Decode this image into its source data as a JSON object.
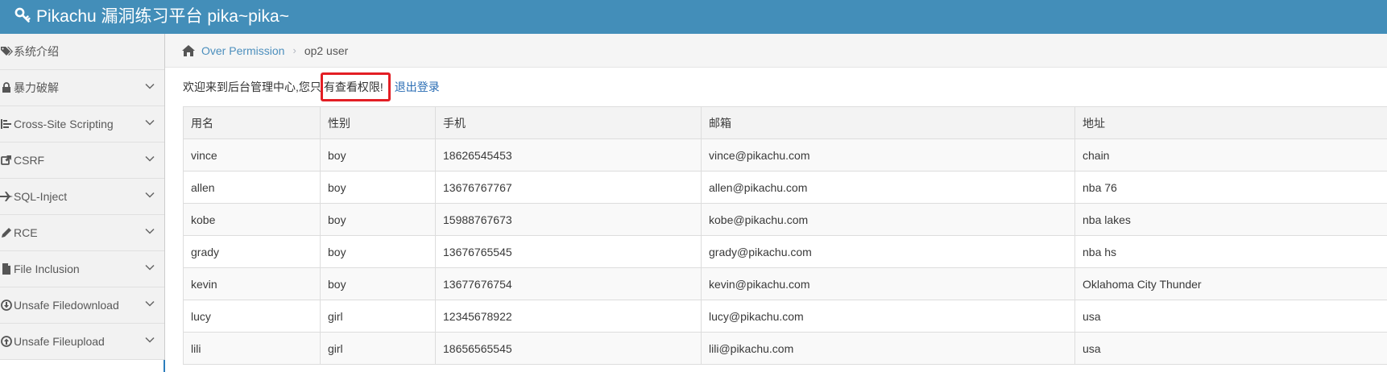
{
  "header": {
    "title": "Pikachu 漏洞练习平台 pika~pika~",
    "icon": "key-icon"
  },
  "sidebar": {
    "items": [
      {
        "label": "系统介绍",
        "icon": "tags-icon"
      },
      {
        "label": "暴力破解",
        "icon": "lock-icon"
      },
      {
        "label": "Cross-Site Scripting",
        "icon": "list-icon"
      },
      {
        "label": "CSRF",
        "icon": "share-icon"
      },
      {
        "label": "SQL-Inject",
        "icon": "fighter-jet-icon"
      },
      {
        "label": "RCE",
        "icon": "pencil-icon"
      },
      {
        "label": "File Inclusion",
        "icon": "file-icon"
      },
      {
        "label": "Unsafe Filedownload",
        "icon": "download-icon"
      },
      {
        "label": "Unsafe Fileupload",
        "icon": "upload-icon"
      }
    ]
  },
  "breadcrumb": {
    "link": "Over Permission",
    "separator": "›",
    "current": "op2 user"
  },
  "welcome": {
    "prefix": "欢迎来到后台管理中心,您只",
    "highlight": "有查看权限!",
    "logout": "退出登录"
  },
  "table": {
    "headers": [
      "用名",
      "性别",
      "手机",
      "邮箱",
      "地址"
    ],
    "rows": [
      [
        "vince",
        "boy",
        "18626545453",
        "vince@pikachu.com",
        "chain"
      ],
      [
        "allen",
        "boy",
        "13676767767",
        "allen@pikachu.com",
        "nba 76"
      ],
      [
        "kobe",
        "boy",
        "15988767673",
        "kobe@pikachu.com",
        "nba lakes"
      ],
      [
        "grady",
        "boy",
        "13676765545",
        "grady@pikachu.com",
        "nba hs"
      ],
      [
        "kevin",
        "boy",
        "13677676754",
        "kevin@pikachu.com",
        "Oklahoma City Thunder"
      ],
      [
        "lucy",
        "girl",
        "12345678922",
        "lucy@pikachu.com",
        "usa"
      ],
      [
        "lili",
        "girl",
        "18656565545",
        "lili@pikachu.com",
        "usa"
      ]
    ]
  },
  "colors": {
    "navbar": "#438eb9",
    "link": "#4c8fbd",
    "highlight_border": "#e31e24"
  }
}
